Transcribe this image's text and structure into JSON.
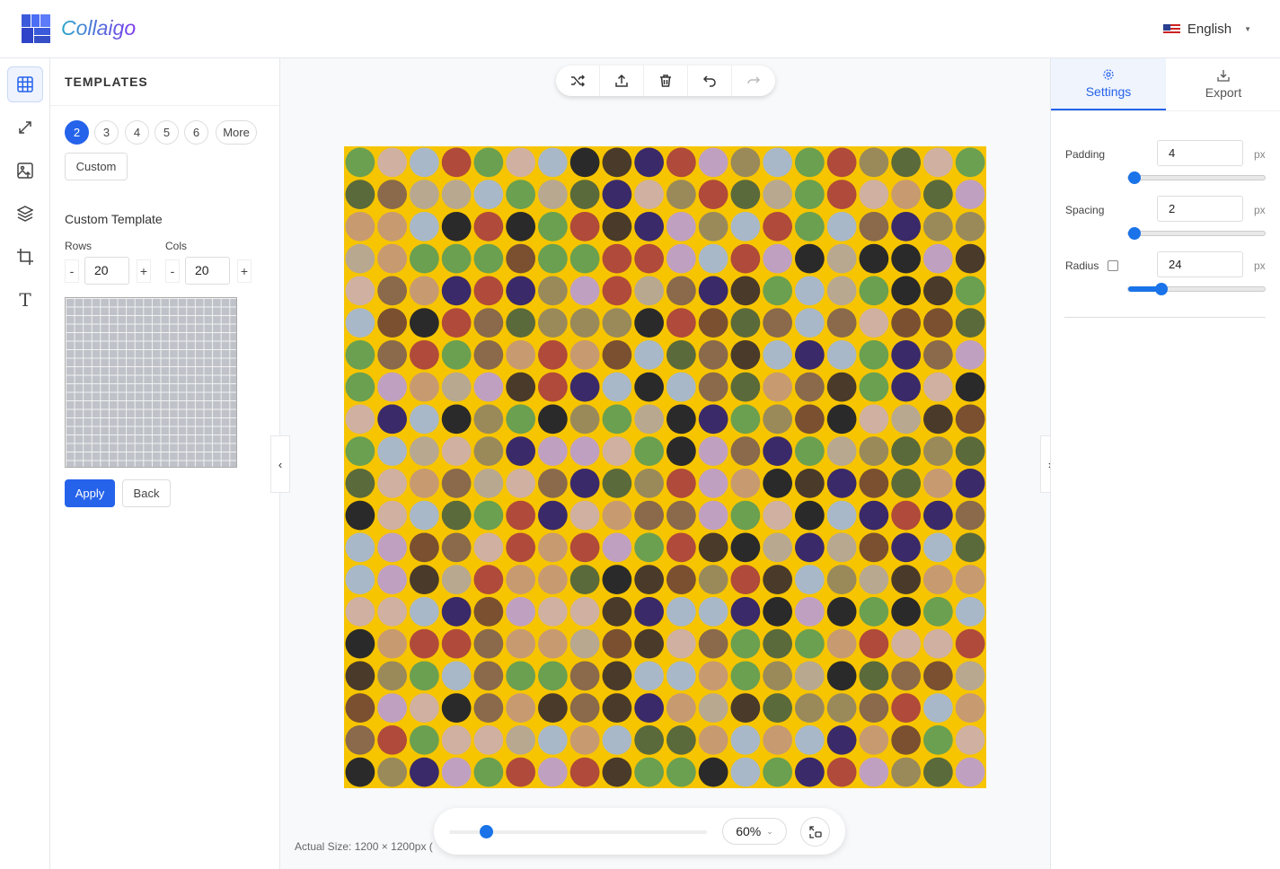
{
  "header": {
    "brand": "Collaigo",
    "language": "English"
  },
  "rail": {
    "items": [
      {
        "name": "templates",
        "icon": "grid-icon",
        "active": true
      },
      {
        "name": "resize",
        "icon": "resize-icon"
      },
      {
        "name": "images",
        "icon": "image-upload-icon"
      },
      {
        "name": "layers",
        "icon": "layers-icon"
      },
      {
        "name": "crop",
        "icon": "crop-icon"
      },
      {
        "name": "text",
        "icon": "text-icon"
      }
    ]
  },
  "templates": {
    "title": "TEMPLATES",
    "counts": [
      "2",
      "3",
      "4",
      "5",
      "6"
    ],
    "selected": "2",
    "more": "More",
    "custom": "Custom",
    "custom_template": {
      "title": "Custom Template",
      "rows_label": "Rows",
      "cols_label": "Cols",
      "rows": "20",
      "cols": "20",
      "minus": "-",
      "plus": "+",
      "apply": "Apply",
      "back": "Back"
    }
  },
  "canvas": {
    "background": "#f7c500",
    "rows": 20,
    "cols": 20,
    "actual_size": "Actual Size: 1200 × 1200px ("
  },
  "zoom": {
    "value": "60%",
    "level": 60
  },
  "settings": {
    "tabs": [
      {
        "label": "Settings",
        "icon": "gear-icon",
        "active": true
      },
      {
        "label": "Export",
        "icon": "download-icon"
      }
    ],
    "padding": {
      "label": "Padding",
      "value": "4",
      "unit": "px",
      "slider": 4,
      "max": 100
    },
    "spacing": {
      "label": "Spacing",
      "value": "2",
      "unit": "px",
      "slider": 2,
      "max": 100
    },
    "radius": {
      "label": "Radius",
      "value": "24",
      "unit": "px",
      "slider": 24,
      "max": 100,
      "checked": false
    }
  },
  "accent": "#2563eb"
}
